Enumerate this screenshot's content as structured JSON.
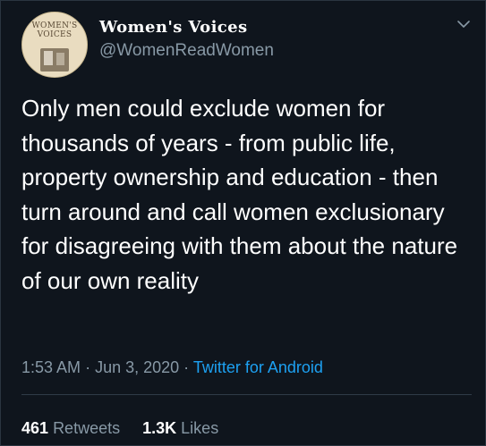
{
  "user": {
    "avatar_text": "WOMEN'S VOICES",
    "display_name": "Women's Voices",
    "handle": "@WomenReadWomen"
  },
  "tweet": {
    "text": "Only men could exclude women for thousands of years - from public life, property ownership and education - then turn around and call women exclusionary for disagreeing with them about the nature of our own reality",
    "time": "1:53 AM",
    "date": "Jun 3, 2020",
    "separator": "·",
    "source": "Twitter for Android"
  },
  "stats": {
    "retweets_count": "461",
    "retweets_label": "Retweets",
    "likes_count": "1.3K",
    "likes_label": "Likes"
  },
  "colors": {
    "background": "#0f151d",
    "muted_text": "#8899a6",
    "link": "#1da1f2"
  },
  "icons": {
    "menu": "chevron-down-icon"
  }
}
